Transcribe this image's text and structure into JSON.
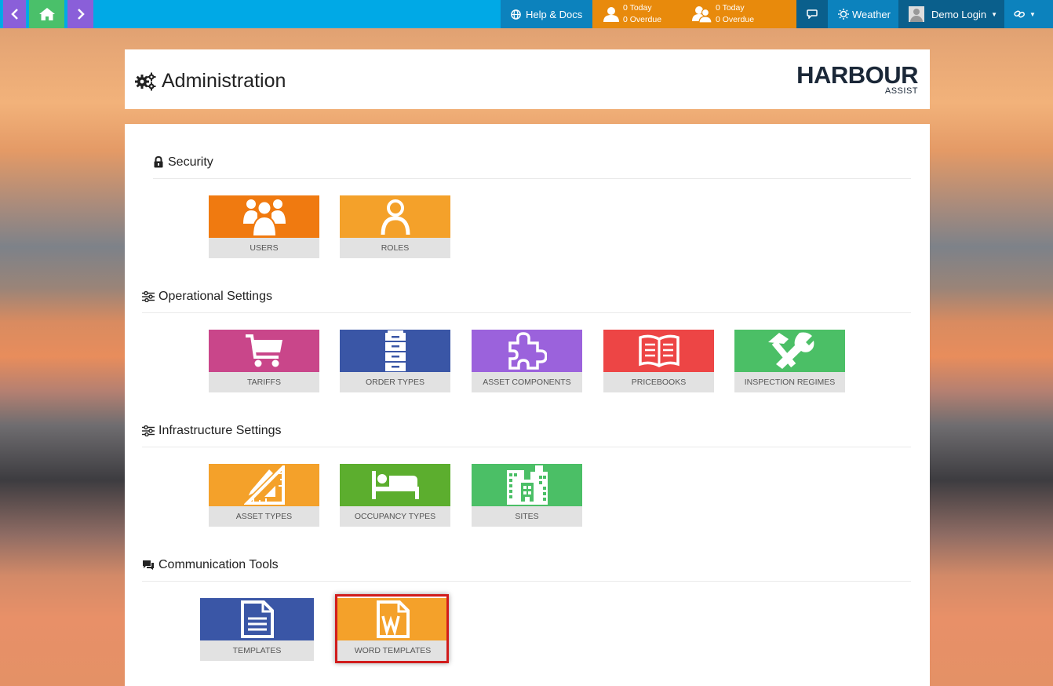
{
  "topbar": {
    "help_label": "Help & Docs",
    "my_tasks": {
      "today": "0 Today",
      "overdue": "0 Overdue"
    },
    "team_tasks": {
      "today": "0 Today",
      "overdue": "0 Overdue"
    },
    "weather_label": "Weather",
    "user_label": "Demo Login",
    "colors": {
      "bar": "#00a9e6",
      "nav_purple": "#8a5fd9",
      "nav_green": "#4ac06a",
      "counts_orange": "#e88a0c"
    }
  },
  "header": {
    "title": "Administration",
    "logo_main": "HARBOUR",
    "logo_sub": "ASSIST"
  },
  "sections": {
    "security": {
      "title": "Security",
      "tiles": [
        {
          "label": "USERS",
          "color": "#f07a10",
          "icon": "users-icon"
        },
        {
          "label": "ROLES",
          "color": "#f4a12a",
          "icon": "user-icon"
        }
      ]
    },
    "operational": {
      "title": "Operational Settings",
      "tiles": [
        {
          "label": "TARIFFS",
          "color": "#c9468a",
          "icon": "cart-icon"
        },
        {
          "label": "ORDER TYPES",
          "color": "#3a56a6",
          "icon": "cabinet-icon"
        },
        {
          "label": "ASSET COMPONENTS",
          "color": "#9b62dc",
          "icon": "puzzle-icon"
        },
        {
          "label": "PRICEBOOKS",
          "color": "#ed4545",
          "icon": "book-icon"
        },
        {
          "label": "INSPECTION REGIMES",
          "color": "#4bbf66",
          "icon": "tools-icon"
        }
      ]
    },
    "infrastructure": {
      "title": "Infrastructure Settings",
      "tiles": [
        {
          "label": "ASSET TYPES",
          "color": "#f4a12a",
          "icon": "ruler-icon"
        },
        {
          "label": "OCCUPANCY TYPES",
          "color": "#5cae2e",
          "icon": "bed-icon"
        },
        {
          "label": "SITES",
          "color": "#4bbf66",
          "icon": "building-icon"
        }
      ]
    },
    "communication": {
      "title": "Communication Tools",
      "tiles": [
        {
          "label": "TEMPLATES",
          "color": "#3a56a6",
          "icon": "document-icon"
        },
        {
          "label": "WORD TEMPLATES",
          "color": "#f4a12a",
          "icon": "word-file-icon"
        }
      ]
    }
  }
}
